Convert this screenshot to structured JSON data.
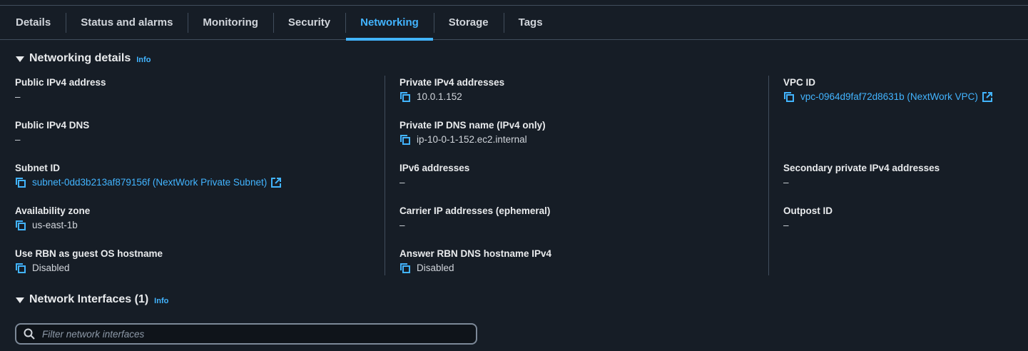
{
  "tabs": [
    {
      "label": "Details"
    },
    {
      "label": "Status and alarms"
    },
    {
      "label": "Monitoring"
    },
    {
      "label": "Security"
    },
    {
      "label": "Networking"
    },
    {
      "label": "Storage"
    },
    {
      "label": "Tags"
    }
  ],
  "active_tab": "Networking",
  "networking_details": {
    "title": "Networking details",
    "info": "Info",
    "public_ipv4_address": {
      "label": "Public IPv4 address",
      "value": "–"
    },
    "public_ipv4_dns": {
      "label": "Public IPv4 DNS",
      "value": "–"
    },
    "subnet_id": {
      "label": "Subnet ID",
      "value": "subnet-0dd3b213af879156f (NextWork Private Subnet)"
    },
    "availability_zone": {
      "label": "Availability zone",
      "value": "us-east-1b"
    },
    "use_rbn_hostname": {
      "label": "Use RBN as guest OS hostname",
      "value": "Disabled"
    },
    "private_ipv4_addresses": {
      "label": "Private IPv4 addresses",
      "value": "10.0.1.152"
    },
    "private_ip_dns_name": {
      "label": "Private IP DNS name (IPv4 only)",
      "value": "ip-10-0-1-152.ec2.internal"
    },
    "ipv6_addresses": {
      "label": "IPv6 addresses",
      "value": "–"
    },
    "carrier_ip_addresses": {
      "label": "Carrier IP addresses (ephemeral)",
      "value": "–"
    },
    "answer_rbn_dns": {
      "label": "Answer RBN DNS hostname IPv4",
      "value": "Disabled"
    },
    "vpc_id": {
      "label": "VPC ID",
      "value": "vpc-0964d9faf72d8631b (NextWork VPC)"
    },
    "secondary_private_ipv4": {
      "label": "Secondary private IPv4 addresses",
      "value": "–"
    },
    "outpost_id": {
      "label": "Outpost ID",
      "value": "–"
    }
  },
  "network_interfaces": {
    "title": "Network Interfaces (1)",
    "info": "Info",
    "filter_placeholder": "Filter network interfaces"
  },
  "colors": {
    "background": "#161d26",
    "accent": "#42b4ff",
    "divider": "#414d5c"
  }
}
